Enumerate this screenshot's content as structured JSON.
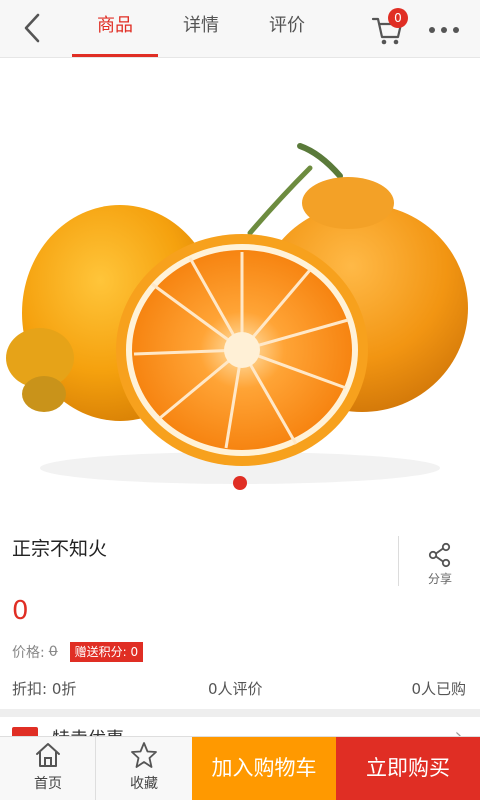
{
  "header": {
    "tabs": [
      {
        "label": "商品",
        "active": true
      },
      {
        "label": "详情",
        "active": false
      },
      {
        "label": "评价",
        "active": false
      }
    ],
    "cart_count": "0",
    "icons": {
      "back": "back-chevron-icon",
      "cart": "cart-icon",
      "more": "more-dots-icon"
    },
    "accent_color": "#e02e24"
  },
  "product": {
    "title": "正宗不知火",
    "share_label": "分享",
    "price": "0",
    "price_label": "价格:",
    "original_price": "0",
    "points_label": "赠送积分: 0",
    "discount": "折扣: 0折",
    "reviews": "0人评价",
    "sold": "0人已购",
    "carousel": {
      "total": 1,
      "current": 1
    }
  },
  "promo": {
    "text": "特卖优惠"
  },
  "bottom_bar": {
    "home_label": "首页",
    "favorite_label": "收藏",
    "add_to_cart_label": "加入购物车",
    "buy_now_label": "立即购买",
    "cart_button_color": "#ff9900",
    "buy_button_color": "#e02e24"
  }
}
